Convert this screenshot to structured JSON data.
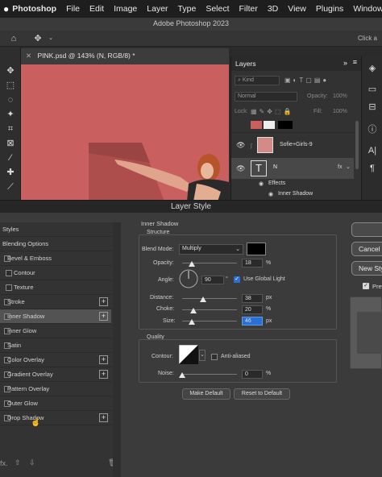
{
  "menubar": {
    "items": [
      "Photoshop",
      "File",
      "Edit",
      "Image",
      "Layer",
      "Type",
      "Select",
      "Filter",
      "3D",
      "View",
      "Plugins",
      "Window"
    ]
  },
  "window": {
    "title": "Adobe Photoshop 2023",
    "click_hint": "Click a"
  },
  "document": {
    "tab_title": "PINK.psd @ 143% (N, RGB/8) *"
  },
  "layers_panel": {
    "title": "Layers",
    "kind_filter": "Kind",
    "blend_mode": "Normal",
    "opacity_label": "Opacity:",
    "opacity_value": "100%",
    "lock_label": "Lock:",
    "fill_label": "Fill:",
    "fill_value": "100%",
    "layers": [
      {
        "name": "Sofie+Girls-9"
      },
      {
        "name": "N"
      }
    ],
    "effects_label": "Effects",
    "effect_item": "Inner Shadow"
  },
  "dialog": {
    "title": "Layer Style",
    "styles_header": "Styles",
    "style_items": [
      {
        "label": "Blending Options",
        "checkbox": false,
        "plus": false,
        "selected": false
      },
      {
        "label": "Bevel & Emboss",
        "checkbox": true,
        "plus": false,
        "selected": false
      },
      {
        "label": "Contour",
        "checkbox": true,
        "plus": false,
        "selected": false
      },
      {
        "label": "Texture",
        "checkbox": true,
        "plus": false,
        "selected": false
      },
      {
        "label": "Stroke",
        "checkbox": true,
        "plus": true,
        "selected": false
      },
      {
        "label": "Inner Shadow",
        "checkbox": true,
        "plus": true,
        "selected": true
      },
      {
        "label": "Inner Glow",
        "checkbox": true,
        "plus": false,
        "selected": false
      },
      {
        "label": "Satin",
        "checkbox": true,
        "plus": false,
        "selected": false
      },
      {
        "label": "Color Overlay",
        "checkbox": true,
        "plus": true,
        "selected": false
      },
      {
        "label": "Gradient Overlay",
        "checkbox": true,
        "plus": true,
        "selected": false
      },
      {
        "label": "Pattern Overlay",
        "checkbox": true,
        "plus": false,
        "selected": false
      },
      {
        "label": "Outer Glow",
        "checkbox": true,
        "plus": false,
        "selected": false
      },
      {
        "label": "Drop Shadow",
        "checkbox": true,
        "plus": true,
        "selected": false
      }
    ],
    "footer_fx": "fx.",
    "section_title": "Inner Shadow",
    "structure": {
      "title": "Structure",
      "blend_mode_label": "Blend Mode:",
      "blend_mode_value": "Multiply",
      "shadow_color": "#000000",
      "opacity_label": "Opacity:",
      "opacity_value": "18",
      "opacity_unit": "%",
      "opacity_level": 0.18,
      "angle_label": "Angle:",
      "angle_value": "90",
      "angle_unit": "°",
      "global_light_label": "Use Global Light",
      "global_light_checked": true,
      "distance_label": "Distance:",
      "distance_value": "38",
      "distance_unit": "px",
      "distance_level": 0.38,
      "choke_label": "Choke:",
      "choke_value": "20",
      "choke_unit": "%",
      "choke_level": 0.2,
      "size_label": "Size:",
      "size_value": "46",
      "size_unit": "px",
      "size_level": 0.18
    },
    "quality": {
      "title": "Quality",
      "contour_label": "Contour:",
      "anti_aliased_label": "Anti-aliased",
      "noise_label": "Noise:",
      "noise_value": "0",
      "noise_unit": "%",
      "noise_level": 0
    },
    "make_default": "Make Default",
    "reset_default": "Reset to Default",
    "right_buttons": [
      "OK",
      "Cancel",
      "New Style..."
    ],
    "preview_label": "Preview"
  },
  "colors": {
    "canvas_bg": "#c9605f",
    "selection_blue": "#2a6fd6"
  }
}
